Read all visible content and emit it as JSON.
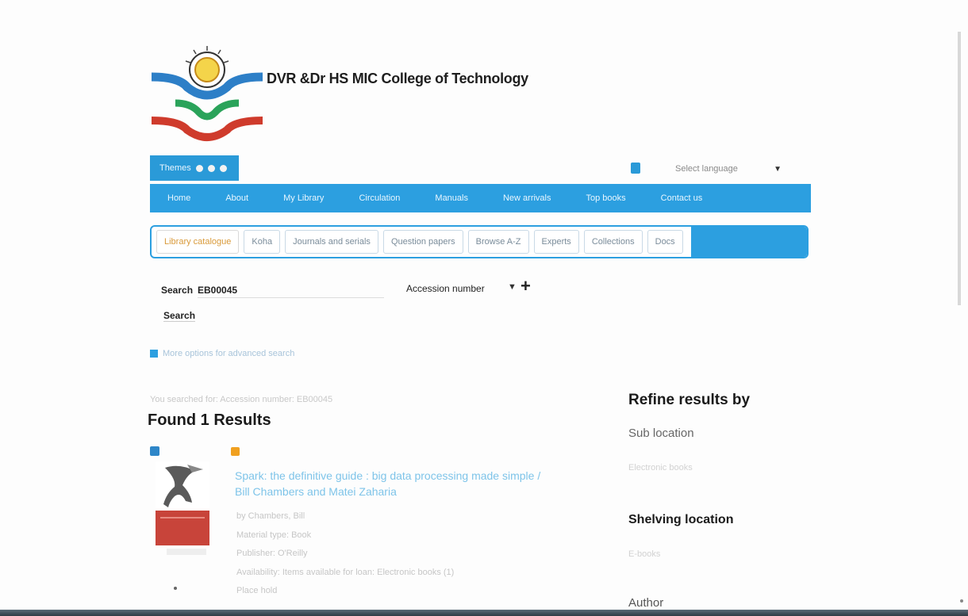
{
  "header": {
    "college_name": "DVR &Dr HS MIC College of Technology",
    "themes_label": "Themes",
    "language_select": "Select language"
  },
  "nav": {
    "items": [
      "Home",
      "About",
      "My Library",
      "Circulation",
      "Manuals",
      "New arrivals",
      "Top books",
      "Contact us"
    ]
  },
  "search_tabs": {
    "items": [
      "Library catalogue",
      "Koha",
      "Journals and serials",
      "Question papers",
      "Browse A-Z",
      "Experts",
      "Collections",
      "Docs"
    ]
  },
  "search": {
    "label": "Search",
    "input_value": "EB00045",
    "field": "Accession number",
    "submit_label": "Search"
  },
  "advanced_link": "More options for advanced search",
  "results": {
    "your_search": "You searched for: Accession number: EB00045",
    "found": "Found 1 Results",
    "item": {
      "title": "Spark: the definitive guide : big data processing made simple / Bill Chambers and Matei Zaharia",
      "meta": [
        "by Chambers, Bill",
        "Material type: Book",
        "Publisher: O'Reilly",
        "Availability: Items available for loan: Electronic books (1)",
        "Place hold"
      ]
    }
  },
  "refine": {
    "title": "Refine results by",
    "sub_location": "Sub location",
    "sub_location_value": "Electronic books",
    "shelving": "Shelving location",
    "shelving_value": "E-books",
    "author": "Author"
  },
  "colors": {
    "accent": "#2c9fe0",
    "link": "#7ec4e9",
    "active_tab": "#d99a3a"
  }
}
